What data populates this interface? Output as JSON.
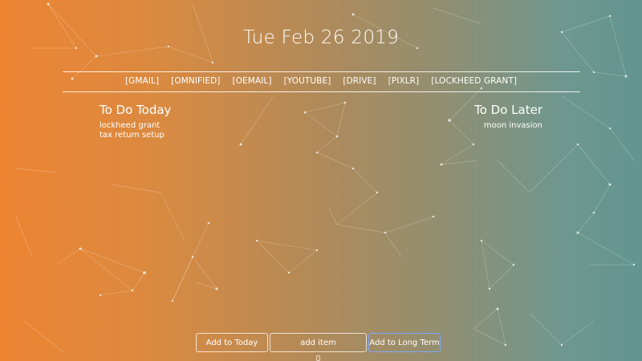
{
  "date": "Tue Feb 26 2019",
  "links": [
    "[GMAIL]",
    "[OMNIFIED]",
    "[OEMAIL]",
    "[YOUTUBE]",
    "[DRIVE]",
    "[PIXLR]",
    "[LOCKHEED GRANT]"
  ],
  "today": {
    "title": "To Do Today",
    "items": [
      "lockheed grant",
      "tax return setup"
    ]
  },
  "later": {
    "title": "To Do Later",
    "items": [
      "moon invasion"
    ]
  },
  "controls": {
    "add_today_label": "Add to Today",
    "item_placeholder": "add item",
    "add_long_term_label": "Add to Long Term"
  },
  "colors": {
    "gradient_left": "#ee8432",
    "gradient_right": "#62968f",
    "text": "#ffffff",
    "focus_border": "#7fa8ff"
  },
  "icons": {
    "background": "particle-network-background"
  }
}
